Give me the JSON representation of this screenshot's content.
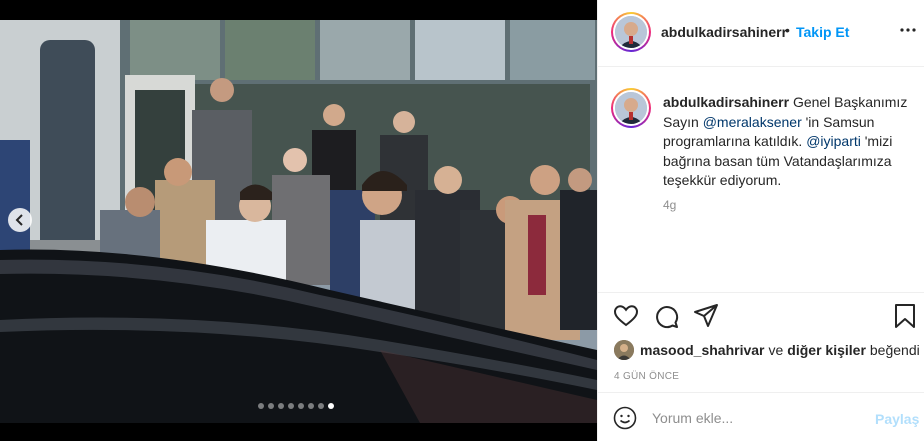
{
  "post": {
    "username": "abdulkadirsahinerr",
    "follow_separator": "•",
    "follow_label": "Takip Et",
    "caption_prefix": "Genel Başkanımız Sayın",
    "mention_1": "@meralaksener",
    "caption_mid": "'in Samsun programlarına katıldık.",
    "mention_2": "@iyiparti",
    "caption_suffix": "'mizi bağrına basan tüm Vatandaşlarımıza teşekkür ediyorum.",
    "caption_time": "4g",
    "liked_by_user": "masood_shahrivar",
    "liked_conj": "ve",
    "liked_others": "diğer kişiler",
    "liked_verb": "beğendi",
    "posted_ago": "4 GÜN ÖNCE",
    "comment_placeholder": "Yorum ekle...",
    "post_button": "Paylaş"
  },
  "carousel": {
    "slide_count": 8,
    "active_index": 7
  },
  "icons": {
    "more": "more-horizontal-icon",
    "like": "heart-icon",
    "comment": "comment-icon",
    "share": "paper-plane-icon",
    "save": "bookmark-icon",
    "emoji": "smiley-icon",
    "prev": "chevron-left-icon"
  },
  "colors": {
    "accent": "#0095f6",
    "mention": "#00376b",
    "muted": "#8e8e8e",
    "post_disabled": "#b2dffc"
  }
}
